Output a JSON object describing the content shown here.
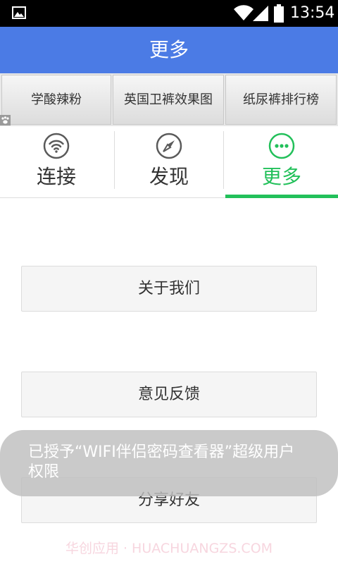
{
  "status_bar": {
    "time": "13:54",
    "icons": [
      "gallery-icon",
      "wifi-icon",
      "signal-icon",
      "battery-icon"
    ]
  },
  "title_bar": {
    "title": "更多"
  },
  "banner": {
    "items": [
      {
        "label": "学酸辣粉"
      },
      {
        "label": "英国卫裤效果图"
      },
      {
        "label": "纸尿裤排行榜"
      }
    ]
  },
  "tabs": [
    {
      "label": "连接",
      "icon": "wifi-icon",
      "active": false
    },
    {
      "label": "发现",
      "icon": "compass-icon",
      "active": false
    },
    {
      "label": "更多",
      "icon": "more-dots-icon",
      "active": true
    }
  ],
  "menu": {
    "about": "关于我们",
    "feedback": "意见反馈",
    "share": "分享好友"
  },
  "toast": {
    "message": "已授予“WIFI伴侣密码查看器”超级用户权限"
  },
  "watermark": {
    "text": "华创应用 · HUACHUANGZS.COM"
  },
  "colors": {
    "title_bar": "#4b7be5",
    "active_tab": "#22c05a",
    "inactive_tab": "#333333",
    "icon_gray": "#5a5a5a"
  }
}
